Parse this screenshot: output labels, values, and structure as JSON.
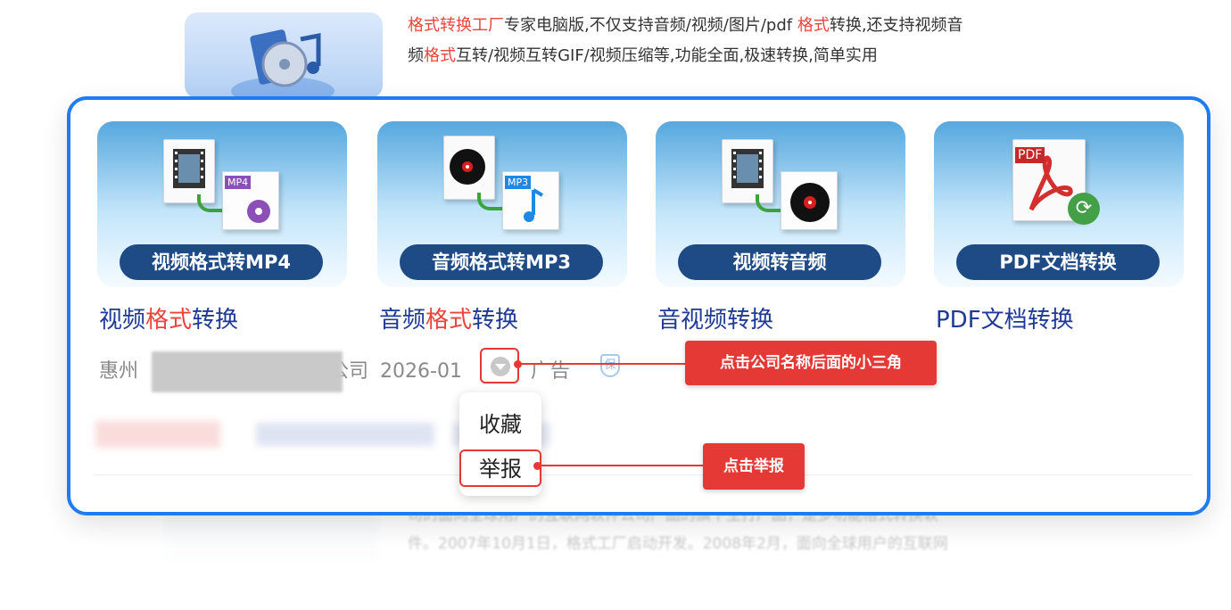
{
  "background_ad": {
    "line1": [
      {
        "text": "格式转换工厂",
        "hl": true
      },
      {
        "text": "专家电脑版,不仅支持音频/视频/图片/pdf ",
        "hl": false
      },
      {
        "text": "格式",
        "hl": true
      },
      {
        "text": "转换,还支持视频音",
        "hl": false
      }
    ],
    "line2": [
      {
        "text": "频",
        "hl": false
      },
      {
        "text": "格式",
        "hl": true
      },
      {
        "text": "互转/视频互转GIF/视频压缩等,功能全面,极速转换,简单实用",
        "hl": false
      }
    ],
    "bottom_line1": "司的面向全球用户的互联网软件公司产品的旗下主打产品，是多功能格式转换软",
    "bottom_line2": "件。2007年10月1日，格式工厂启动开发。2008年2月，面向全球用户的互联网"
  },
  "tiles": [
    {
      "pill": "视频格式转MP4",
      "tag": "MP4",
      "title_pre": "视频",
      "title_hl": "格式",
      "title_post": "转换"
    },
    {
      "pill": "音频格式转MP3",
      "tag": "MP3",
      "title_pre": "音频",
      "title_hl": "格式",
      "title_post": "转换"
    },
    {
      "pill": "视频转音频",
      "tag": "",
      "title_pre": "音视频转换",
      "title_hl": "",
      "title_post": ""
    },
    {
      "pill": "PDF文档转换",
      "tag": "PDF",
      "title_pre": "PDF文档转换",
      "title_hl": "",
      "title_post": ""
    }
  ],
  "meta": {
    "company_prefix": "惠州",
    "company_suffix": "公司",
    "date": "2026-01",
    "ad_label": "广告",
    "shield_label": "保"
  },
  "popup": {
    "favorite": "收藏",
    "report": "举报"
  },
  "callouts": {
    "triangle": "点击公司名称后面的小三角",
    "report": "点击举报"
  },
  "colors": {
    "accent_blue": "#1f7cf0",
    "callout_red": "#e53935",
    "highlight_red": "#e8453c",
    "link_blue": "#1e3a96"
  }
}
